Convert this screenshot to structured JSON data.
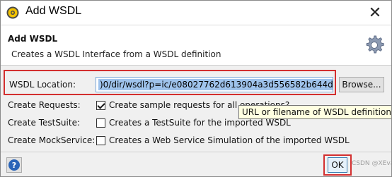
{
  "window": {
    "title": "Add WSDL",
    "close_glyph": "✕"
  },
  "header": {
    "title": "Add WSDL",
    "description": "Creates a WSDL Interface from a WSDL definition",
    "icon": "gear-icon"
  },
  "form": {
    "wsdl_location_label": "WSDL Location:",
    "wsdl_location_value": ")0/dir/wsdl?p=ic/e08027762d613904a3d556582b644d8d",
    "browse_label": "Browse...",
    "create_requests_label": "Create Requests:",
    "create_requests_option": "Create sample requests for all operations?",
    "create_requests_checked": true,
    "create_testsuite_label": "Create TestSuite:",
    "create_testsuite_option": "Creates a TestSuite for the imported WSDL",
    "create_testsuite_checked": false,
    "create_mockservice_label": "Create MockService:",
    "create_mockservice_option": "Creates a Web Service Simulation of the imported WSDL",
    "create_mockservice_checked": false,
    "tooltip": "URL or filename of WSDL definition"
  },
  "footer": {
    "help_glyph": "?",
    "ok_label": "OK",
    "watermark": "CSDN @XEvan"
  },
  "colors": {
    "highlight_red": "#d32f2f",
    "selection_blue": "#9fc3ec",
    "help_blue": "#2a64b8"
  }
}
